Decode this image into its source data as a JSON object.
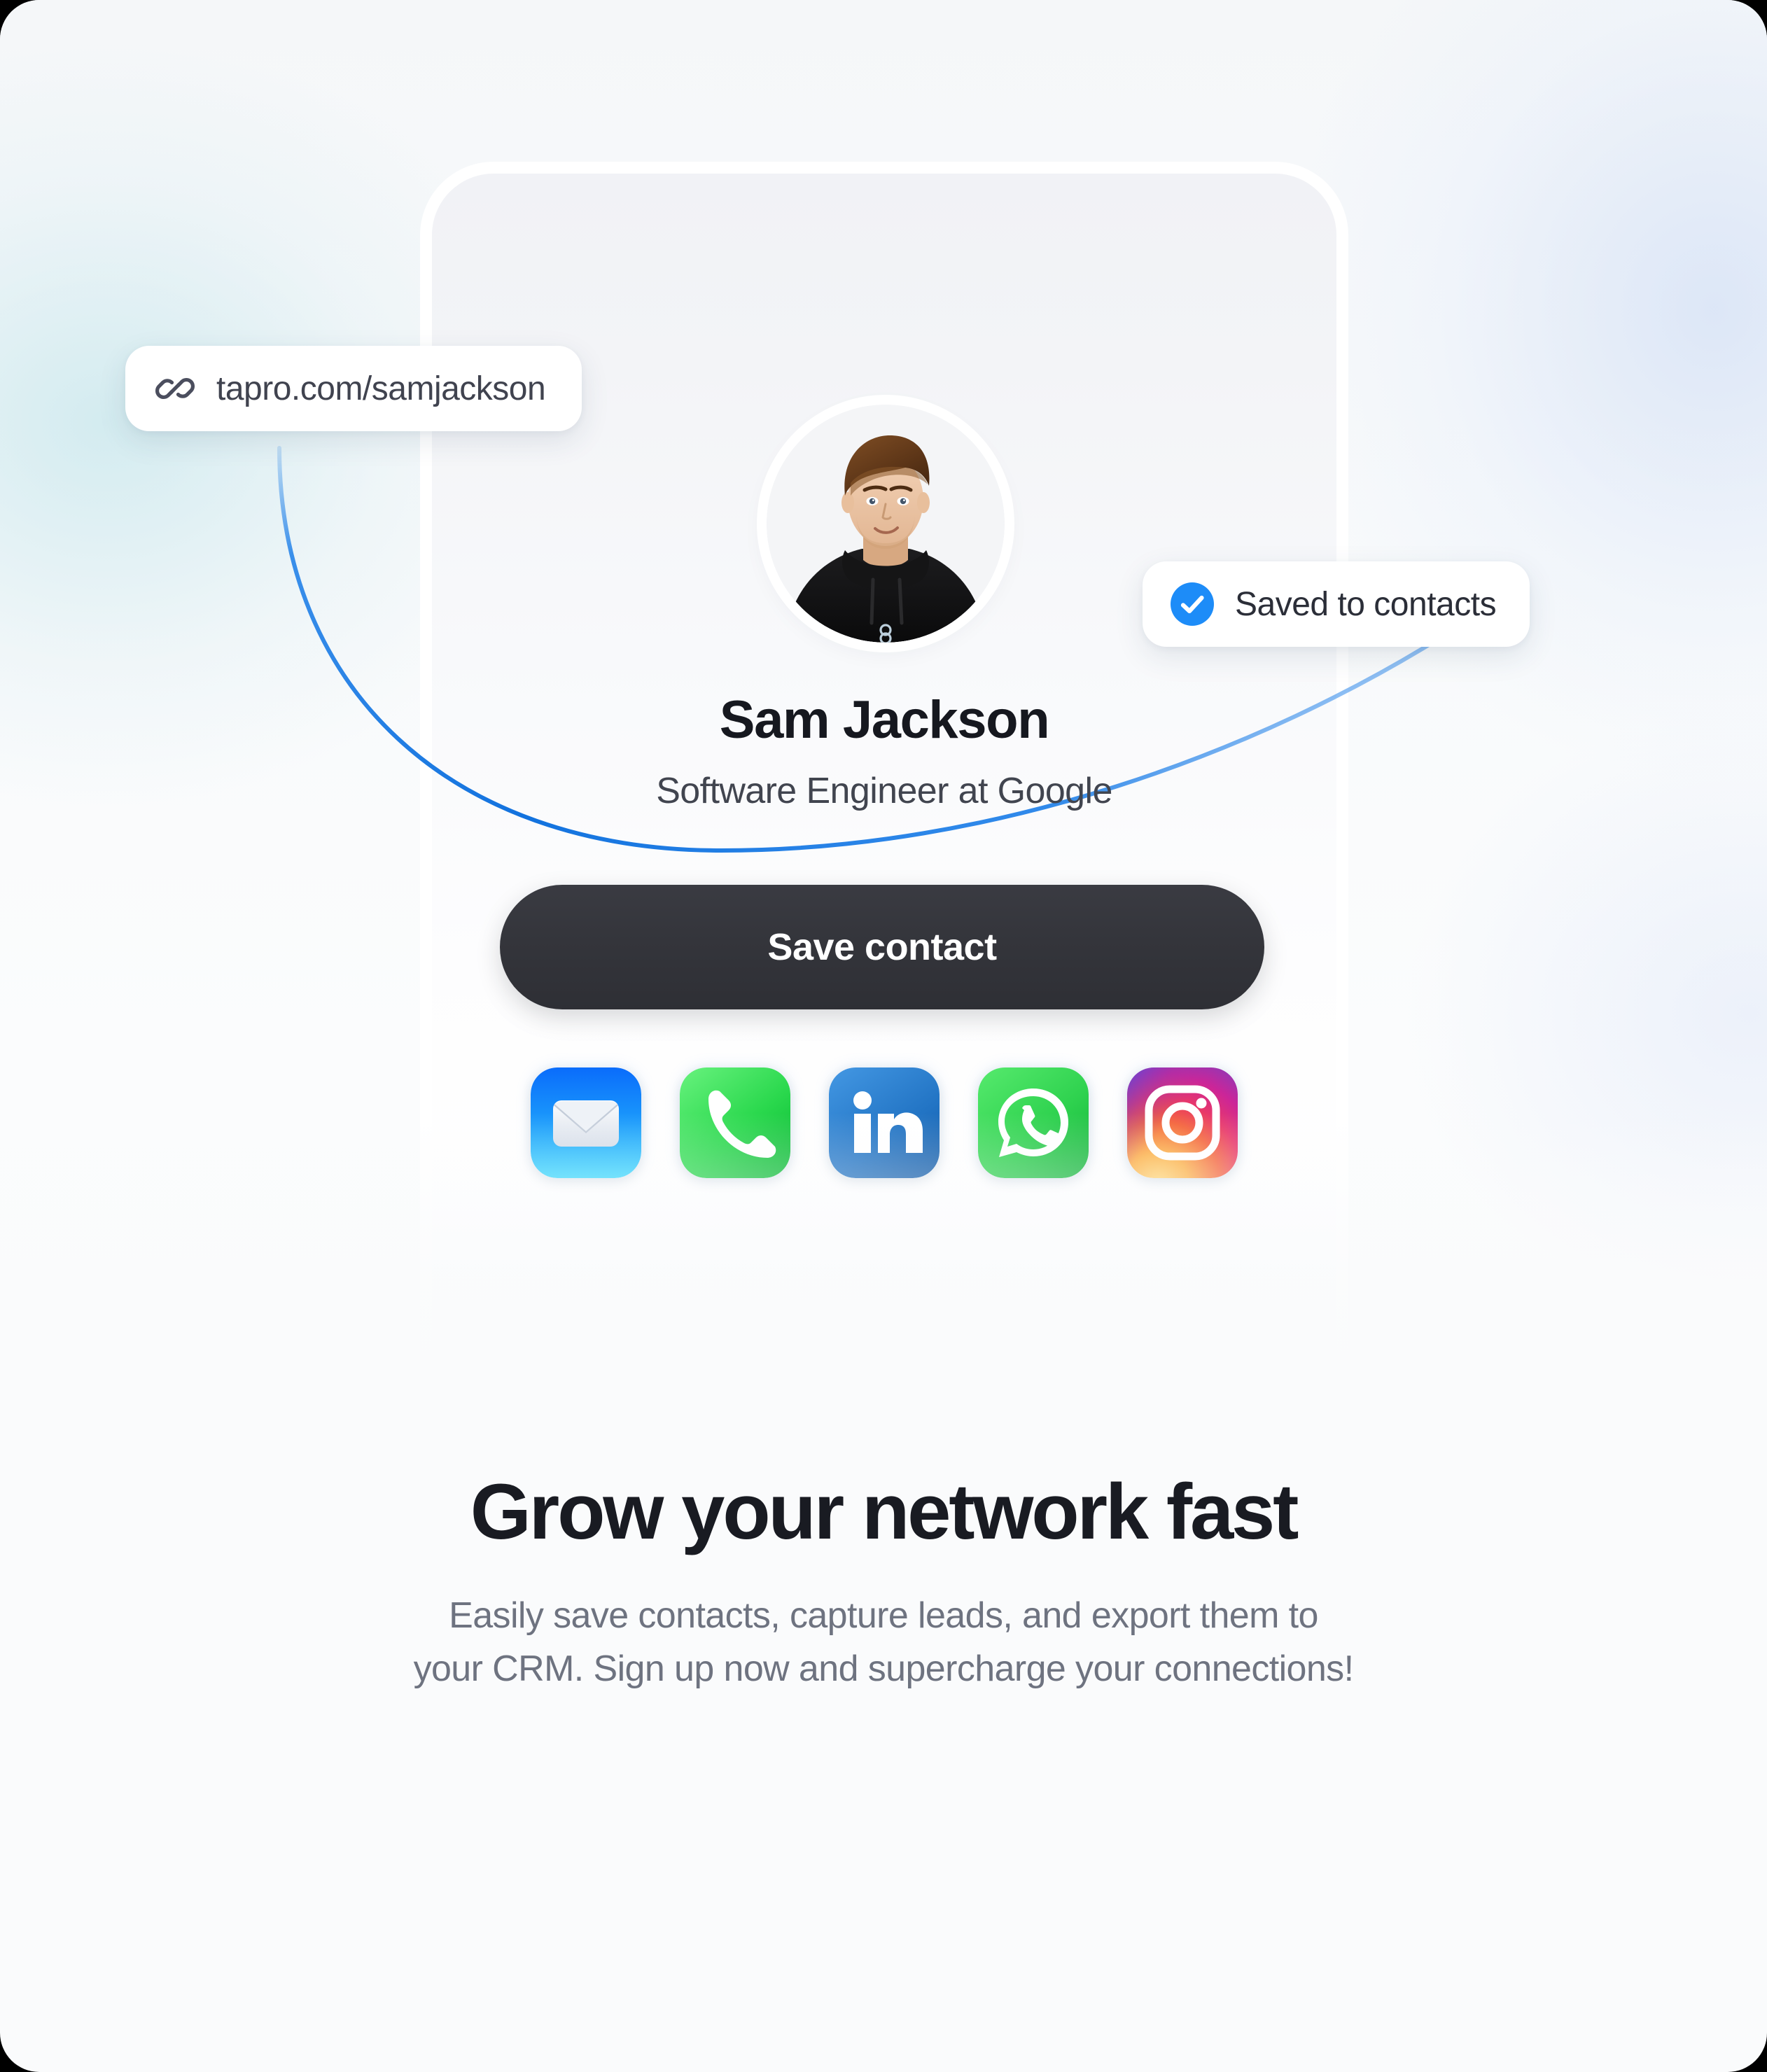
{
  "profile": {
    "name": "Sam Jackson",
    "title": "Software Engineer at Google",
    "avatar_alt": "Sam Jackson portrait",
    "save_button_label": "Save contact",
    "social_links": [
      {
        "name": "mail",
        "label": "Email"
      },
      {
        "name": "phone",
        "label": "Phone"
      },
      {
        "name": "linkedin",
        "label": "LinkedIn"
      },
      {
        "name": "whatsapp",
        "label": "WhatsApp"
      },
      {
        "name": "instagram",
        "label": "Instagram"
      }
    ]
  },
  "badges": {
    "url_pill": {
      "icon": "link-icon",
      "text": "tapro.com/samjackson"
    },
    "saved_pill": {
      "icon": "check-circle-icon",
      "text": "Saved to contacts"
    }
  },
  "copy": {
    "headline": "Grow your network fast",
    "subcopy_line1": "Easily save contacts, capture leads, and export them to",
    "subcopy_line2": "your CRM. Sign up now and supercharge your connections!"
  },
  "colors": {
    "accent_blue": "#1a7de8",
    "check_blue": "#1d8cf8",
    "button_dark": "#34353b",
    "headline": "#191b22",
    "body_text": "#6e7380",
    "page_bg": "#fafbfc"
  }
}
